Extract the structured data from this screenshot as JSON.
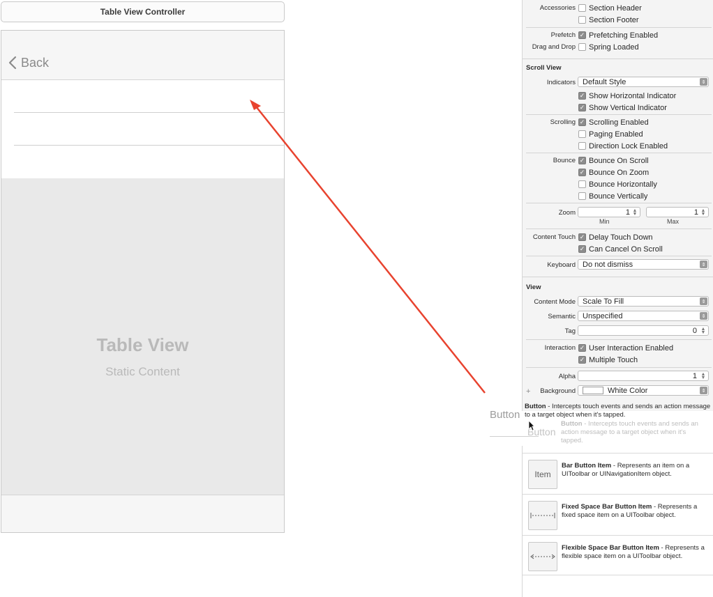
{
  "canvas": {
    "vc_title": "Table View Controller",
    "back_label": "Back",
    "table_title": "Table View",
    "table_subtitle": "Static Content"
  },
  "inspector": {
    "accessories_label": "Accessories",
    "section_header": "Section Header",
    "section_footer": "Section Footer",
    "prefetch_label": "Prefetch",
    "prefetching_enabled": "Prefetching Enabled",
    "drag_drop_label": "Drag and Drop",
    "spring_loaded": "Spring Loaded",
    "scroll_view_header": "Scroll View",
    "indicators_label": "Indicators",
    "indicators_value": "Default Style",
    "show_horizontal": "Show Horizontal Indicator",
    "show_vertical": "Show Vertical Indicator",
    "scrolling_label": "Scrolling",
    "scrolling_enabled": "Scrolling Enabled",
    "paging_enabled": "Paging Enabled",
    "direction_lock": "Direction Lock Enabled",
    "bounce_label": "Bounce",
    "bounce_on_scroll": "Bounce On Scroll",
    "bounce_on_zoom": "Bounce On Zoom",
    "bounce_horizontally": "Bounce Horizontally",
    "bounce_vertically": "Bounce Vertically",
    "zoom_label": "Zoom",
    "zoom_min_value": "1",
    "zoom_max_value": "1",
    "zoom_min_caption": "Min",
    "zoom_max_caption": "Max",
    "content_touch_label": "Content Touch",
    "delay_touch_down": "Delay Touch Down",
    "can_cancel_on_scroll": "Can Cancel On Scroll",
    "keyboard_label": "Keyboard",
    "keyboard_value": "Do not dismiss",
    "view_header": "View",
    "content_mode_label": "Content Mode",
    "content_mode_value": "Scale To Fill",
    "semantic_label": "Semantic",
    "semantic_value": "Unspecified",
    "tag_label": "Tag",
    "tag_value": "0",
    "interaction_label": "Interaction",
    "user_interaction_enabled": "User Interaction Enabled",
    "multiple_touch": "Multiple Touch",
    "alpha_label": "Alpha",
    "alpha_value": "1",
    "background_label": "Background",
    "background_value": "White Color"
  },
  "drag": {
    "ghost_button": "Button",
    "ghost_button_small": "Button",
    "tooltip_title": "Button",
    "tooltip_text": " - Intercepts touch events and sends an action message to a target object when it's tapped.",
    "tooltip_faded_title": "Button",
    "tooltip_faded_text": " - Intercepts touch events and sends an action message to a target object when it's tapped."
  },
  "library": {
    "items": [
      {
        "icon": "Item",
        "title": "Bar Button Item",
        "desc": " - Represents an item on a UIToolbar or UINavigationItem object."
      },
      {
        "icon": "",
        "title": "Fixed Space Bar Button Item",
        "desc": " - Represents a fixed space item on a UIToolbar object."
      },
      {
        "icon": "",
        "title": "Flexible Space Bar Button Item",
        "desc": " - Represents a flexible space item on a UIToolbar object."
      }
    ]
  },
  "colors": {
    "arrow": "#e8432f",
    "checkbox_on": "#8d8d8d",
    "canvas_bg": "#e9e9e9"
  }
}
